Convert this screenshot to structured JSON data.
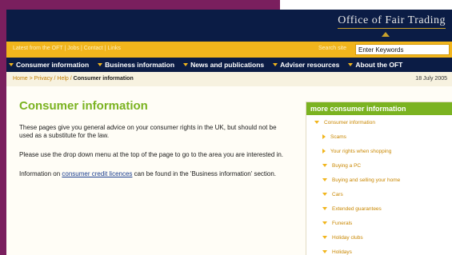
{
  "brand": {
    "name": "Office of Fair Trading"
  },
  "utility": {
    "links": "Latest from the OFT | Jobs | Contact | Links",
    "search_label": "Search site",
    "search_value": "Enter Keywords"
  },
  "nav": {
    "items": [
      {
        "label": "Consumer information"
      },
      {
        "label": "Business information"
      },
      {
        "label": "News and publications"
      },
      {
        "label": "Adviser resources"
      },
      {
        "label": "About the OFT"
      }
    ]
  },
  "breadcrumb": {
    "trail": "Home > Privacy / Help / ",
    "current": "Consumer information",
    "date": "18 July 2005"
  },
  "main": {
    "title": "Consumer information",
    "p1": "These pages give you general advice on your consumer rights in the UK, but should not be used as a substitute for the law.",
    "p2": "Please use the drop down menu at the top of the page to go to the area you are interested in.",
    "p3_before": "Information on ",
    "p3_link": "consumer credit licences",
    "p3_after": " can be found in the 'Business information' section."
  },
  "sidebar": {
    "header": "more consumer information",
    "items": [
      {
        "label": "Consumer information",
        "level": "top"
      },
      {
        "label": "Scams",
        "level": "sub"
      },
      {
        "label": "Your rights when shopping",
        "level": "sub"
      },
      {
        "label": "Buying a PC",
        "level": "sub"
      },
      {
        "label": "Buying and selling your home",
        "level": "sub"
      },
      {
        "label": "Cars",
        "level": "sub"
      },
      {
        "label": "Extended guarantees",
        "level": "sub"
      },
      {
        "label": "Funerals",
        "level": "sub"
      },
      {
        "label": "Holiday clubs",
        "level": "sub"
      },
      {
        "label": "Holidays",
        "level": "sub"
      }
    ]
  },
  "colors": {
    "navy": "#0b1c45",
    "gold": "#f1b51c",
    "green": "#7bb321",
    "purple": "#7a1f5e"
  }
}
